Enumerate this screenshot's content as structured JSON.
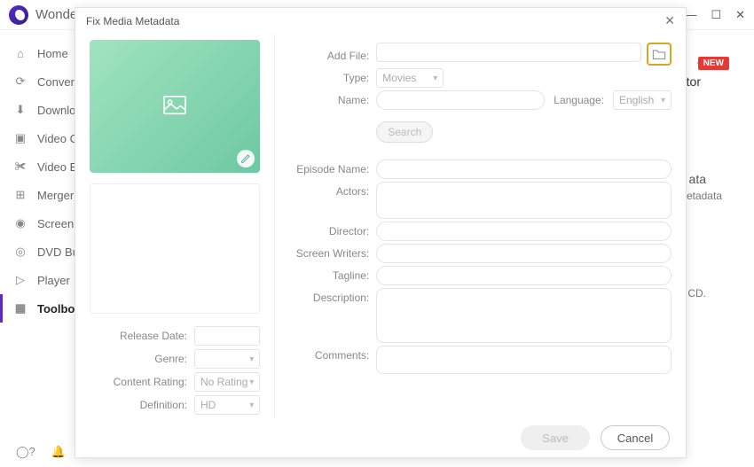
{
  "brand": "Wonder",
  "window_controls": {
    "min": "—",
    "max": "☐",
    "close": "✕"
  },
  "sidebar": {
    "items": [
      {
        "icon": "home",
        "label": "Home"
      },
      {
        "icon": "convert",
        "label": "Converter"
      },
      {
        "icon": "download",
        "label": "Download"
      },
      {
        "icon": "video-compress",
        "label": "Video Compress"
      },
      {
        "icon": "video-edit",
        "label": "Video Editor"
      },
      {
        "icon": "merger",
        "label": "Merger"
      },
      {
        "icon": "screen-rec",
        "label": "Screen Recorder"
      },
      {
        "icon": "dvd",
        "label": "DVD Burner"
      },
      {
        "icon": "player",
        "label": "Player"
      },
      {
        "icon": "toolbox",
        "label": "Toolbox"
      }
    ]
  },
  "background": {
    "new_badge": "NEW",
    "peek_title": "tor",
    "peek_sub1": "ata",
    "peek_sub2": "etadata",
    "peek_cd": "CD."
  },
  "modal": {
    "title": "Fix Media Metadata",
    "left": {
      "release_date_label": "Release Date:",
      "genre_label": "Genre:",
      "content_rating_label": "Content Rating:",
      "content_rating_value": "No Rating",
      "definition_label": "Definition:",
      "definition_value": "HD"
    },
    "right": {
      "add_file_label": "Add File:",
      "type_label": "Type:",
      "type_value": "Movies",
      "name_label": "Name:",
      "language_label": "Language:",
      "language_value": "English",
      "search_label": "Search",
      "episode_label": "Episode Name:",
      "actors_label": "Actors:",
      "director_label": "Director:",
      "writers_label": "Screen Writers:",
      "tagline_label": "Tagline:",
      "description_label": "Description:",
      "comments_label": "Comments:"
    },
    "footer": {
      "save": "Save",
      "cancel": "Cancel"
    }
  }
}
